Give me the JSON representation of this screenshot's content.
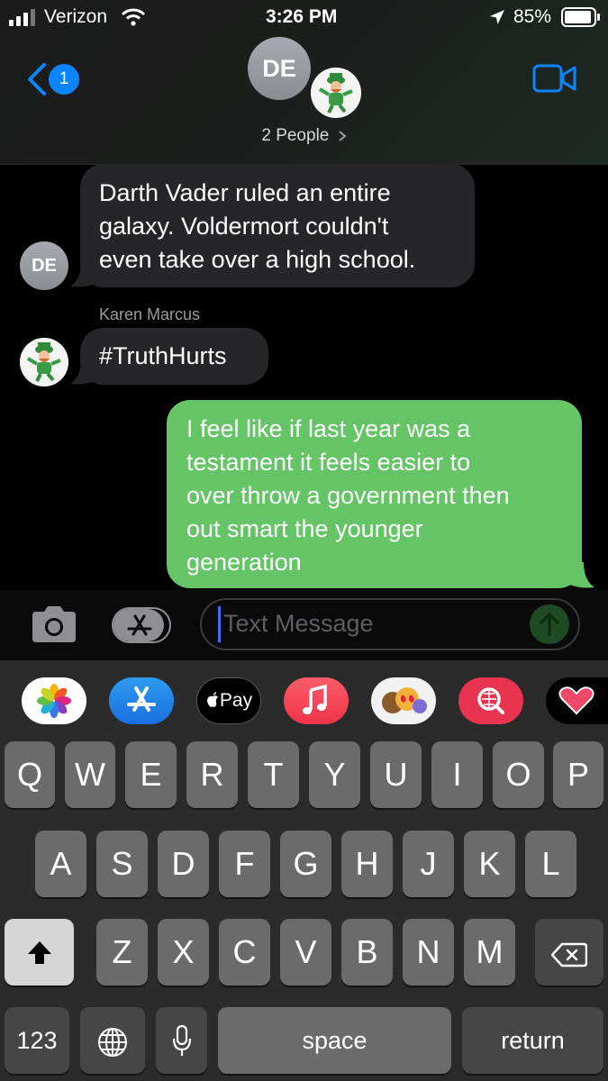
{
  "status_bar": {
    "carrier": "Verizon",
    "time": "3:26 PM",
    "battery": "85%"
  },
  "header": {
    "back_badge": "1",
    "group_avatar_initials": "DE",
    "participants_label": "2 People",
    "icons": [
      "back-chevron-icon",
      "video-call-icon",
      "chevron-right-icon"
    ]
  },
  "messages": [
    {
      "from": "DE",
      "type": "incoming",
      "lines": [
        "Darth Vader ruled an entire",
        "galaxy. Voldermort couldn't",
        "even take over a high school."
      ]
    },
    {
      "from": "Karen Marcus",
      "sender_label": "Karen Marcus",
      "type": "incoming",
      "lines": [
        "#TruthHurts"
      ]
    },
    {
      "from": "me",
      "type": "outgoing",
      "lines": [
        "I feel like if last year was a",
        "testament it feels easier to",
        "over throw a government then",
        "out smart the younger",
        "generation"
      ]
    }
  ],
  "input": {
    "placeholder": "Text Message"
  },
  "app_drawer": {
    "apple_pay_label": "Pay",
    "apps": [
      "photos-icon",
      "app-store-icon",
      "apple-pay-icon",
      "music-icon",
      "memoji-icon",
      "web-search-icon",
      "digital-touch-icon"
    ]
  },
  "keyboard": {
    "row1": [
      "Q",
      "W",
      "E",
      "R",
      "T",
      "Y",
      "U",
      "I",
      "O",
      "P"
    ],
    "row2": [
      "A",
      "S",
      "D",
      "F",
      "G",
      "H",
      "J",
      "K",
      "L"
    ],
    "row3": [
      "Z",
      "X",
      "C",
      "V",
      "B",
      "N",
      "M"
    ],
    "numbers_key": "123",
    "space_key": "space",
    "return_key": "return"
  }
}
